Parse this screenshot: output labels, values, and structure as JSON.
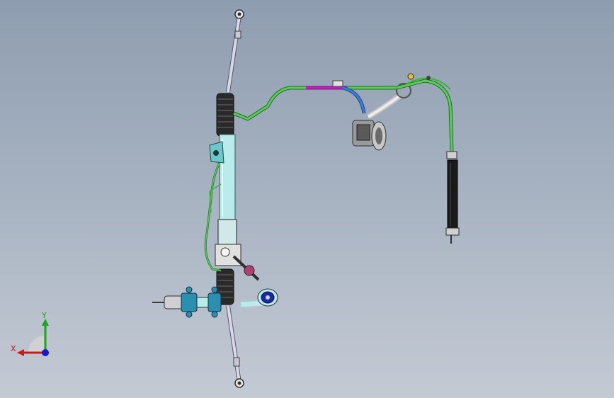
{
  "viewport": {
    "background_top": "#8e9db0",
    "background_bottom": "#c4cad4"
  },
  "model": {
    "colors": {
      "tie_rod": "#d8d8e8",
      "rack_housing": "#b8ecec",
      "boot": "#2a2a2a",
      "hose_green": "#3cb43c",
      "hose_magenta": "#c020c0",
      "hose_blue": "#3a7fd0",
      "reservoir": "#1a1a1a",
      "mount_blue": "#2a8fb0",
      "pump_gray": "#8c8c8c"
    }
  },
  "triad": {
    "x_label": "X",
    "y_label": "Y",
    "x_color": "#d01818",
    "y_color": "#18a818",
    "z_color": "#1818d0"
  }
}
